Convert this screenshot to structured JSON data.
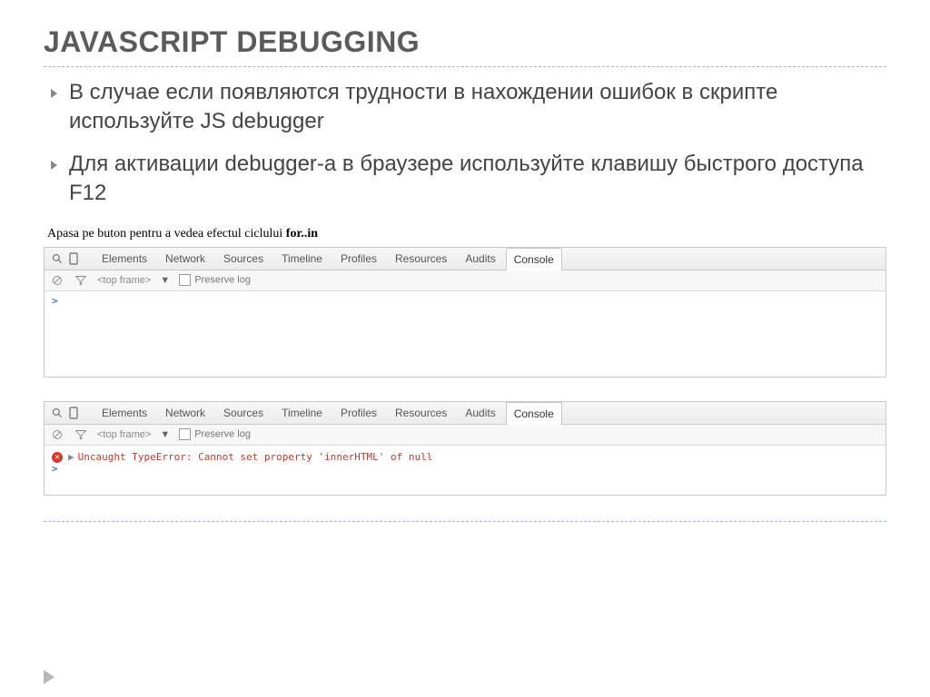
{
  "title": "JAVASCRIPT DEBUGGING",
  "bullets": [
    "В случае если появляются трудности в нахождении ошибок в скрипте используйте JS debugger",
    "Для активации debugger-а в браузере используйте клавишу быстрого доступа F12"
  ],
  "page_caption_prefix": "Apasa pe buton pentru a vedea efectul ciclului ",
  "page_caption_bold": "for..in",
  "devtools": {
    "tabs": [
      "Elements",
      "Network",
      "Sources",
      "Timeline",
      "Profiles",
      "Resources",
      "Audits",
      "Console"
    ],
    "active_tab": "Console",
    "top_frame": "<top frame>",
    "preserve_log": "Preserve log",
    "prompt": ">",
    "error_text": "Uncaught TypeError: Cannot set property 'innerHTML' of null"
  }
}
